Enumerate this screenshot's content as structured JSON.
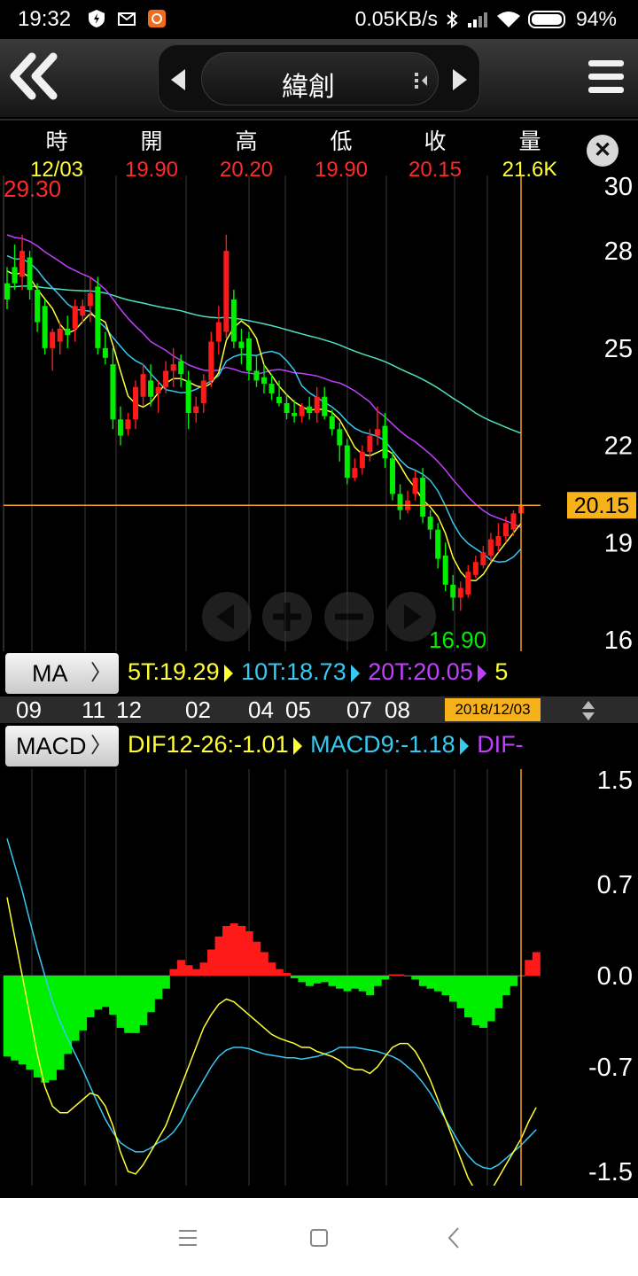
{
  "status_bar": {
    "time": "19:32",
    "net_speed": "0.05KB/s",
    "battery": "94%"
  },
  "header": {
    "title": "緯創"
  },
  "quote": {
    "columns": [
      {
        "label": "時",
        "value": "12/03",
        "color": "#ffff33"
      },
      {
        "label": "開",
        "value": "19.90",
        "color": "#ff2a2a"
      },
      {
        "label": "高",
        "value": "20.20",
        "color": "#ff2a2a"
      },
      {
        "label": "低",
        "value": "19.90",
        "color": "#ff2a2a"
      },
      {
        "label": "收",
        "value": "20.15",
        "color": "#ff2a2a"
      },
      {
        "label": "量",
        "value": "21.6K",
        "color": "#ffff33"
      }
    ]
  },
  "price_chart": {
    "max_label": "29.30",
    "min_label": "16.90",
    "current_price": "20.15",
    "y_ticks": [
      "30",
      "28",
      "25",
      "22",
      "19",
      "16"
    ]
  },
  "ma_panel": {
    "button_label": "MA",
    "legend": [
      {
        "text": "5T:19.29",
        "color": "#ffff33"
      },
      {
        "text": "10T:18.73",
        "color": "#38c8f0"
      },
      {
        "text": "20T:20.05",
        "color": "#c040ff"
      },
      {
        "text": "5",
        "color": "#ffff33"
      }
    ]
  },
  "x_axis": {
    "labels": [
      "09",
      "11",
      "12",
      "02",
      "04",
      "05",
      "07",
      "08"
    ],
    "cursor_date": "2018/12/03"
  },
  "macd_panel": {
    "button_label": "MACD",
    "legend": [
      {
        "text": "DIF12-26:-1.01",
        "color": "#ffff33"
      },
      {
        "text": "MACD9:-1.18",
        "color": "#38c8f0"
      },
      {
        "text": "DIF-",
        "color": "#c040ff"
      }
    ],
    "y_ticks": [
      "1.5",
      "0.7",
      "0.0",
      "-0.7",
      "-1.5"
    ]
  },
  "colors": {
    "up": "#ff1a1a",
    "down": "#00ee00",
    "ma5": "#ffff33",
    "ma10": "#38c8f0",
    "ma20": "#c040ff",
    "ma60": "#50e0c0",
    "cursor": "#f0a020",
    "badge": "#f7b21b"
  },
  "chart_data": [
    {
      "type": "candlestick",
      "title": "",
      "ylim": [
        16,
        30
      ],
      "y_ticks": [
        30,
        28,
        25,
        22,
        19,
        16
      ],
      "grid": true,
      "ohlc": [
        [
          27.0,
          27.5,
          26.2,
          26.5
        ],
        [
          27.5,
          28.2,
          26.8,
          27.0
        ],
        [
          27.2,
          28.5,
          26.8,
          28.0
        ],
        [
          27.8,
          28.0,
          26.5,
          26.8
        ],
        [
          26.8,
          27.0,
          25.5,
          25.8
        ],
        [
          26.3,
          26.5,
          24.8,
          25.0
        ],
        [
          25.0,
          25.6,
          24.3,
          25.5
        ],
        [
          25.2,
          25.8,
          24.8,
          25.6
        ],
        [
          25.6,
          26.0,
          25.0,
          25.4
        ],
        [
          25.6,
          26.5,
          25.2,
          26.3
        ],
        [
          26.0,
          26.5,
          25.8,
          26.3
        ],
        [
          26.3,
          27.2,
          25.8,
          26.7
        ],
        [
          26.9,
          27.2,
          24.8,
          25.0
        ],
        [
          25.0,
          25.5,
          24.5,
          24.7
        ],
        [
          24.5,
          25.0,
          22.5,
          22.8
        ],
        [
          22.8,
          23.2,
          22.0,
          22.3
        ],
        [
          22.5,
          23.0,
          22.3,
          22.8
        ],
        [
          22.8,
          24.0,
          22.5,
          23.8
        ],
        [
          23.5,
          24.5,
          23.2,
          24.2
        ],
        [
          24.0,
          24.5,
          23.2,
          23.5
        ],
        [
          23.6,
          24.0,
          23.0,
          23.8
        ],
        [
          23.8,
          24.6,
          23.6,
          24.3
        ],
        [
          24.3,
          25.0,
          23.8,
          24.5
        ],
        [
          24.6,
          24.8,
          23.8,
          24.2
        ],
        [
          24.0,
          24.3,
          22.5,
          23.0
        ],
        [
          23.0,
          23.5,
          22.7,
          23.2
        ],
        [
          23.3,
          24.2,
          23.0,
          24.0
        ],
        [
          24.0,
          25.5,
          23.8,
          25.2
        ],
        [
          25.2,
          26.3,
          24.8,
          25.8
        ],
        [
          25.5,
          28.5,
          25.3,
          28.0
        ],
        [
          26.5,
          26.8,
          25.0,
          25.2
        ],
        [
          25.2,
          25.6,
          24.5,
          25.0
        ],
        [
          25.3,
          25.5,
          24.0,
          24.3
        ],
        [
          24.3,
          24.8,
          23.8,
          24.0
        ],
        [
          24.1,
          24.5,
          23.6,
          23.9
        ],
        [
          23.9,
          24.2,
          23.4,
          23.6
        ],
        [
          23.5,
          24.0,
          23.2,
          23.3
        ],
        [
          23.3,
          23.6,
          22.8,
          23.0
        ],
        [
          23.0,
          23.4,
          22.7,
          22.9
        ],
        [
          22.9,
          23.3,
          22.7,
          23.2
        ],
        [
          23.2,
          23.5,
          22.8,
          23.0
        ],
        [
          23.0,
          23.8,
          22.7,
          23.5
        ],
        [
          23.5,
          23.8,
          22.8,
          22.9
        ],
        [
          22.9,
          23.1,
          22.3,
          22.5
        ],
        [
          22.5,
          22.7,
          21.5,
          22.0
        ],
        [
          22.0,
          22.2,
          20.8,
          21.0
        ],
        [
          21.0,
          21.6,
          20.9,
          21.3
        ],
        [
          21.3,
          22.0,
          21.1,
          21.8
        ],
        [
          21.8,
          22.5,
          21.5,
          22.3
        ],
        [
          22.3,
          23.2,
          22.0,
          22.5
        ],
        [
          22.6,
          23.0,
          21.3,
          21.6
        ],
        [
          21.6,
          21.8,
          20.3,
          20.5
        ],
        [
          20.5,
          20.8,
          19.7,
          20.0
        ],
        [
          20.0,
          20.6,
          19.9,
          20.3
        ],
        [
          20.5,
          21.2,
          20.3,
          21.0
        ],
        [
          21.0,
          21.3,
          19.6,
          19.8
        ],
        [
          19.8,
          20.0,
          19.1,
          19.4
        ],
        [
          19.4,
          19.6,
          18.2,
          18.5
        ],
        [
          18.6,
          19.0,
          17.5,
          17.7
        ],
        [
          17.7,
          18.0,
          16.9,
          17.3
        ],
        [
          17.3,
          17.8,
          16.9,
          17.6
        ],
        [
          17.4,
          18.3,
          17.3,
          18.1
        ],
        [
          18.0,
          18.6,
          17.9,
          18.4
        ],
        [
          18.3,
          18.9,
          18.2,
          18.7
        ],
        [
          18.6,
          19.3,
          18.4,
          19.1
        ],
        [
          18.9,
          19.6,
          18.7,
          19.2
        ],
        [
          19.2,
          19.8,
          19.0,
          19.6
        ],
        [
          19.4,
          20.0,
          19.2,
          19.9
        ],
        [
          19.9,
          20.2,
          19.9,
          20.15
        ]
      ],
      "ma5_last": 19.29,
      "ma10_last": 18.73,
      "ma20_last": 20.05
    },
    {
      "type": "macd",
      "ylim": [
        -1.5,
        1.5
      ],
      "y_ticks": [
        1.5,
        0.7,
        0.0,
        -0.7,
        -1.5
      ],
      "histogram": [
        -0.62,
        -0.65,
        -0.68,
        -0.72,
        -0.78,
        -0.82,
        -0.8,
        -0.72,
        -0.6,
        -0.5,
        -0.42,
        -0.32,
        -0.26,
        -0.24,
        -0.3,
        -0.4,
        -0.44,
        -0.44,
        -0.38,
        -0.28,
        -0.18,
        -0.1,
        0.05,
        0.12,
        0.08,
        0.05,
        0.1,
        0.2,
        0.3,
        0.38,
        0.4,
        0.38,
        0.34,
        0.26,
        0.18,
        0.1,
        0.05,
        0.02,
        -0.02,
        -0.05,
        -0.08,
        -0.06,
        -0.05,
        -0.08,
        -0.1,
        -0.12,
        -0.1,
        -0.12,
        -0.15,
        -0.08,
        -0.03,
        0.01,
        0.01,
        0.0,
        -0.03,
        -0.08,
        -0.1,
        -0.12,
        -0.15,
        -0.2,
        -0.25,
        -0.32,
        -0.38,
        -0.4,
        -0.35,
        -0.25,
        -0.15,
        -0.08,
        0.0,
        0.12,
        0.18
      ],
      "dif": [
        0.6,
        0.3,
        0.0,
        -0.3,
        -0.6,
        -0.85,
        -1.0,
        -1.05,
        -1.05,
        -1.0,
        -0.95,
        -0.9,
        -0.92,
        -1.0,
        -1.15,
        -1.35,
        -1.5,
        -1.52,
        -1.45,
        -1.35,
        -1.25,
        -1.15,
        -1.0,
        -0.85,
        -0.7,
        -0.55,
        -0.4,
        -0.3,
        -0.22,
        -0.18,
        -0.2,
        -0.25,
        -0.3,
        -0.35,
        -0.4,
        -0.45,
        -0.48,
        -0.5,
        -0.52,
        -0.55,
        -0.55,
        -0.58,
        -0.6,
        -0.62,
        -0.65,
        -0.7,
        -0.72,
        -0.72,
        -0.75,
        -0.7,
        -0.62,
        -0.55,
        -0.52,
        -0.52,
        -0.58,
        -0.68,
        -0.8,
        -0.95,
        -1.1,
        -1.25,
        -1.4,
        -1.55,
        -1.65,
        -1.68,
        -1.65,
        -1.55,
        -1.45,
        -1.35,
        -1.25,
        -1.12,
        -1.01
      ],
      "macd": [
        1.05,
        0.85,
        0.65,
        0.42,
        0.2,
        0.0,
        -0.2,
        -0.35,
        -0.48,
        -0.6,
        -0.72,
        -0.85,
        -0.98,
        -1.1,
        -1.2,
        -1.28,
        -1.32,
        -1.35,
        -1.35,
        -1.32,
        -1.28,
        -1.25,
        -1.2,
        -1.12,
        -1.0,
        -0.9,
        -0.8,
        -0.7,
        -0.62,
        -0.57,
        -0.55,
        -0.55,
        -0.56,
        -0.58,
        -0.6,
        -0.61,
        -0.62,
        -0.63,
        -0.63,
        -0.64,
        -0.63,
        -0.62,
        -0.6,
        -0.58,
        -0.55,
        -0.55,
        -0.55,
        -0.56,
        -0.57,
        -0.58,
        -0.6,
        -0.62,
        -0.65,
        -0.7,
        -0.75,
        -0.82,
        -0.9,
        -1.0,
        -1.1,
        -1.2,
        -1.3,
        -1.38,
        -1.44,
        -1.47,
        -1.48,
        -1.45,
        -1.4,
        -1.35,
        -1.3,
        -1.24,
        -1.18
      ]
    }
  ]
}
